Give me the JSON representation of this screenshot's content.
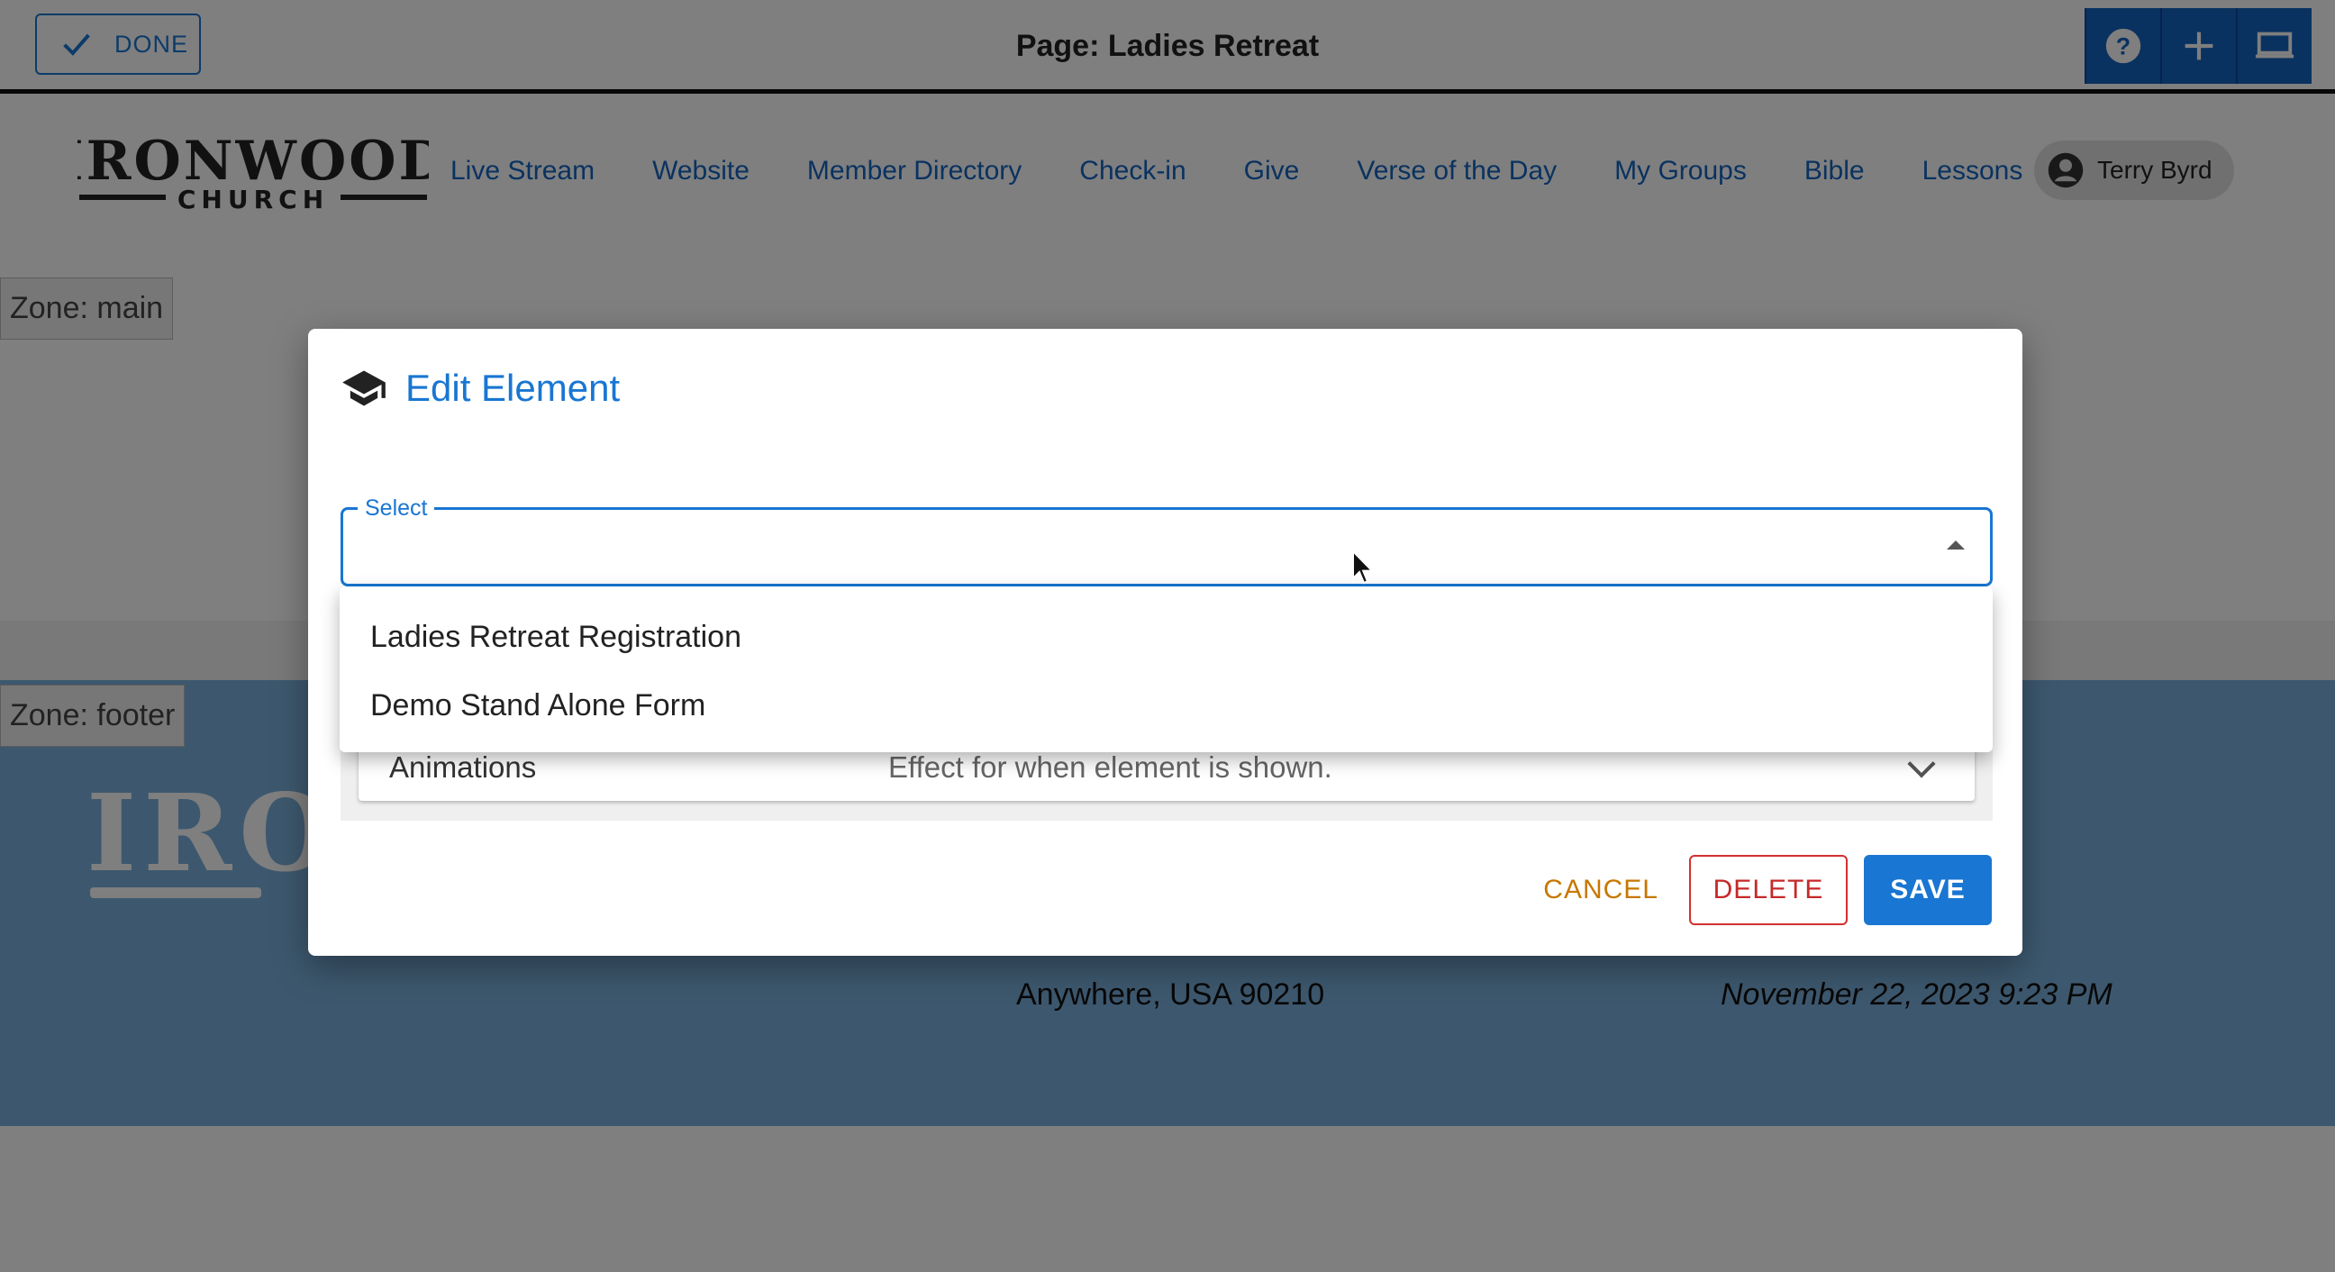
{
  "topbar": {
    "done_label": "DONE",
    "page_title": "Page: Ladies Retreat",
    "tools": [
      "help-icon",
      "add-icon",
      "desktop-icon"
    ]
  },
  "navbar": {
    "logo_text": "IRONWOOD",
    "logo_subtext": "CHURCH",
    "links": [
      "Live Stream",
      "Website",
      "Member Directory",
      "Check-in",
      "Give",
      "Verse of the Day",
      "My Groups",
      "Bible",
      "Lessons"
    ],
    "user_name": "Terry Byrd"
  },
  "zones": {
    "main": "Zone: main",
    "footer": "Zone: footer"
  },
  "footer": {
    "logo_text": "IRO",
    "address": "Anywhere, USA 90210",
    "date": "November 22, 2023 9:23 PM"
  },
  "dialog": {
    "title": "Edit Element",
    "select_label": "Select",
    "accordion_title": "Animations",
    "accordion_desc": "Effect for when element is shown.",
    "cancel_label": "CANCEL",
    "delete_label": "DELETE",
    "save_label": "SAVE"
  },
  "menu": {
    "options": [
      "Ladies Retreat Registration",
      "Demo Stand Alone Form"
    ]
  },
  "colors": {
    "primary": "#1976d2",
    "cancel": "#c77700",
    "delete": "#c62828",
    "footer_bg": "#7ab0dc"
  }
}
